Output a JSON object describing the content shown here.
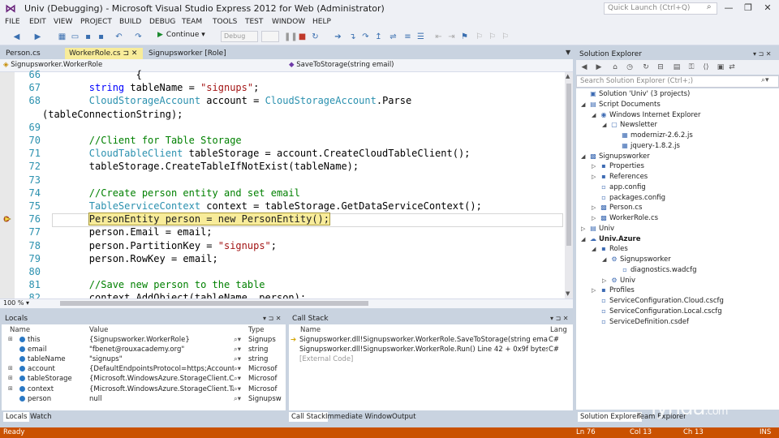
{
  "window": {
    "title": "Univ (Debugging) - Microsoft Visual Studio Express 2012 for Web (Administrator)",
    "quick_launch_placeholder": "Quick Launch (Ctrl+Q)",
    "minimize": "—",
    "restore": "❐",
    "close": "✕"
  },
  "menu": [
    "FILE",
    "EDIT",
    "VIEW",
    "PROJECT",
    "BUILD",
    "DEBUG",
    "TEAM",
    "TOOLS",
    "TEST",
    "WINDOW",
    "HELP"
  ],
  "toolbar": {
    "continue_label": "Continue",
    "continue_arrow": "▾",
    "config_value": "Debug",
    "icons": [
      "back-icon",
      "forward-icon",
      "new-project-icon",
      "open-icon",
      "save-icon",
      "save-all-icon",
      "undo-icon",
      "redo-icon"
    ]
  },
  "doc_tabs": [
    {
      "label": "Person.cs",
      "active": false
    },
    {
      "label": "WorkerRole.cs",
      "active": true,
      "pin": "⊐",
      "close": "✕"
    },
    {
      "label": "Signupsworker [Role]",
      "active": false
    }
  ],
  "nav": {
    "left": "Signupsworker.WorkerRole",
    "right": "SaveToStorage(string email)"
  },
  "editor": {
    "zoom": "100 %",
    "lines": [
      {
        "n": "66",
        "parts": [
          {
            "c": "pl",
            "t": "                {"
          }
        ]
      },
      {
        "n": "67",
        "parts": [
          {
            "c": "pl",
            "t": "        "
          },
          {
            "c": "kw",
            "t": "string"
          },
          {
            "c": "pl",
            "t": " tableName = "
          },
          {
            "c": "str",
            "t": "\"signups\""
          },
          {
            "c": "pl",
            "t": ";"
          }
        ]
      },
      {
        "n": "68",
        "parts": [
          {
            "c": "pl",
            "t": "        "
          },
          {
            "c": "ty",
            "t": "CloudStorageAccount"
          },
          {
            "c": "pl",
            "t": " account = "
          },
          {
            "c": "ty",
            "t": "CloudStorageAccount"
          },
          {
            "c": "pl",
            "t": ".Parse"
          }
        ]
      },
      {
        "n": "",
        "parts": [
          {
            "c": "pl",
            "t": "(tableConnectionString);"
          }
        ]
      },
      {
        "n": "69",
        "parts": []
      },
      {
        "n": "70",
        "parts": [
          {
            "c": "pl",
            "t": "        "
          },
          {
            "c": "cm",
            "t": "//Client for Table Storage"
          }
        ]
      },
      {
        "n": "71",
        "parts": [
          {
            "c": "pl",
            "t": "        "
          },
          {
            "c": "ty",
            "t": "CloudTableClient"
          },
          {
            "c": "pl",
            "t": " tableStorage = account.CreateCloudTableClient();"
          }
        ]
      },
      {
        "n": "72",
        "parts": [
          {
            "c": "pl",
            "t": "        tableStorage.CreateTableIfNotExist(tableName);"
          }
        ]
      },
      {
        "n": "73",
        "parts": []
      },
      {
        "n": "74",
        "parts": [
          {
            "c": "pl",
            "t": "        "
          },
          {
            "c": "cm",
            "t": "//Create person entity and set email"
          }
        ]
      },
      {
        "n": "75",
        "parts": [
          {
            "c": "pl",
            "t": "        "
          },
          {
            "c": "ty",
            "t": "TableServiceContext"
          },
          {
            "c": "pl",
            "t": " context = tableStorage.GetDataServiceContext();"
          }
        ]
      },
      {
        "n": "76",
        "parts": [
          {
            "c": "pl",
            "t": "        "
          },
          {
            "c": "cur",
            "t": "PersonEntity person = new PersonEntity();"
          }
        ]
      },
      {
        "n": "77",
        "parts": [
          {
            "c": "pl",
            "t": "        person.Email = email;"
          }
        ]
      },
      {
        "n": "78",
        "parts": [
          {
            "c": "pl",
            "t": "        person.PartitionKey = "
          },
          {
            "c": "str",
            "t": "\"signups\""
          },
          {
            "c": "pl",
            "t": ";"
          }
        ]
      },
      {
        "n": "79",
        "parts": [
          {
            "c": "pl",
            "t": "        person.RowKey = email;"
          }
        ]
      },
      {
        "n": "80",
        "parts": []
      },
      {
        "n": "81",
        "parts": [
          {
            "c": "pl",
            "t": "        "
          },
          {
            "c": "cm",
            "t": "//Save new person to the table"
          }
        ]
      },
      {
        "n": "82",
        "parts": [
          {
            "c": "pl",
            "t": "        context.AddObject(tableName, person);"
          }
        ]
      }
    ]
  },
  "locals": {
    "title": "Locals",
    "columns": [
      "Name",
      "Value",
      "Type"
    ],
    "rows": [
      {
        "exp": "⊞",
        "name": "this",
        "value": "{Signupsworker.WorkerRole}",
        "type": "Signups"
      },
      {
        "exp": "",
        "name": "email",
        "value": "\"fbenet@rouxacademy.org\"",
        "type": "string"
      },
      {
        "exp": "",
        "name": "tableName",
        "value": "\"signups\"",
        "type": "string"
      },
      {
        "exp": "⊞",
        "name": "account",
        "value": "{DefaultEndpointsProtocol=https;AccountName=u",
        "type": "Microsof"
      },
      {
        "exp": "⊞",
        "name": "tableStorage",
        "value": "{Microsoft.WindowsAzure.StorageClient.CloudTabl",
        "type": "Microsof"
      },
      {
        "exp": "⊞",
        "name": "context",
        "value": "{Microsoft.WindowsAzure.StorageClient.TableServic",
        "type": "Microsof"
      },
      {
        "exp": "",
        "name": "person",
        "value": "null",
        "type": "Signupsw"
      }
    ],
    "tabs": [
      "Locals",
      "Watch"
    ]
  },
  "callstack": {
    "title": "Call Stack",
    "columns": [
      "Name",
      "Lang"
    ],
    "rows": [
      {
        "name": "Signupsworker.dll!Signupsworker.WorkerRole.SaveToStorage(string email) Line 76",
        "lang": "C#",
        "current": true
      },
      {
        "name": "Signupsworker.dll!Signupsworker.WorkerRole.Run() Line 42 + 0x9f bytes",
        "lang": "C#",
        "current": false
      },
      {
        "name": "[External Code]",
        "lang": "",
        "current": false
      }
    ],
    "tabs": [
      "Call Stack",
      "Immediate Window",
      "Output"
    ]
  },
  "solution_explorer": {
    "title": "Solution Explorer",
    "search_placeholder": "Search Solution Explorer (Ctrl+;)",
    "tree": [
      {
        "depth": 0,
        "exp": "",
        "icon": "▣",
        "label": "Solution 'Univ' (3 projects)",
        "bold": false
      },
      {
        "depth": 0,
        "exp": "◢",
        "icon": "▤",
        "label": "Script Documents",
        "bold": false
      },
      {
        "depth": 1,
        "exp": "◢",
        "icon": "◉",
        "label": "Windows Internet Explorer",
        "bold": false
      },
      {
        "depth": 2,
        "exp": "◢",
        "icon": "▢",
        "label": "Newsletter",
        "bold": false
      },
      {
        "depth": 3,
        "exp": "",
        "icon": "▦",
        "label": "modernizr-2.6.2.js",
        "bold": false
      },
      {
        "depth": 3,
        "exp": "",
        "icon": "▦",
        "label": "jquery-1.8.2.js",
        "bold": false
      },
      {
        "depth": 0,
        "exp": "◢",
        "icon": "▩",
        "label": "Signupsworker",
        "bold": false
      },
      {
        "depth": 1,
        "exp": "▷",
        "icon": "▪",
        "label": "Properties",
        "bold": false
      },
      {
        "depth": 1,
        "exp": "▷",
        "icon": "▪",
        "label": "References",
        "bold": false
      },
      {
        "depth": 1,
        "exp": "",
        "icon": "▫",
        "label": "app.config",
        "bold": false
      },
      {
        "depth": 1,
        "exp": "",
        "icon": "▫",
        "label": "packages.config",
        "bold": false
      },
      {
        "depth": 1,
        "exp": "▷",
        "icon": "▩",
        "label": "Person.cs",
        "bold": false
      },
      {
        "depth": 1,
        "exp": "▷",
        "icon": "▩",
        "label": "WorkerRole.cs",
        "bold": false
      },
      {
        "depth": 0,
        "exp": "▷",
        "icon": "▤",
        "label": "Univ",
        "bold": false
      },
      {
        "depth": 0,
        "exp": "◢",
        "icon": "☁",
        "label": "Univ.Azure",
        "bold": true
      },
      {
        "depth": 1,
        "exp": "◢",
        "icon": "▪",
        "label": "Roles",
        "bold": false
      },
      {
        "depth": 2,
        "exp": "◢",
        "icon": "⚙",
        "label": "Signupsworker",
        "bold": false
      },
      {
        "depth": 3,
        "exp": "",
        "icon": "▫",
        "label": "diagnostics.wadcfg",
        "bold": false
      },
      {
        "depth": 2,
        "exp": "▷",
        "icon": "⚙",
        "label": "Univ",
        "bold": false
      },
      {
        "depth": 1,
        "exp": "▷",
        "icon": "▪",
        "label": "Profiles",
        "bold": false
      },
      {
        "depth": 1,
        "exp": "",
        "icon": "▫",
        "label": "ServiceConfiguration.Cloud.cscfg",
        "bold": false
      },
      {
        "depth": 1,
        "exp": "",
        "icon": "▫",
        "label": "ServiceConfiguration.Local.cscfg",
        "bold": false
      },
      {
        "depth": 1,
        "exp": "",
        "icon": "▫",
        "label": "ServiceDefinition.csdef",
        "bold": false
      }
    ],
    "tabs": [
      "Solution Explorer",
      "Team Explorer"
    ]
  },
  "statusbar": {
    "left": "Ready",
    "ln": "Ln 76",
    "col": "Col 13",
    "ch": "Ch 13",
    "mode": "INS"
  },
  "watermark": "lynda",
  "watermark_suffix": ".com",
  "colors": {
    "status_bar": "#ca5100",
    "current_statement": "#f8ec9a",
    "keyword": "#0000ff",
    "type": "#2b91af",
    "string": "#a31515",
    "comment": "#008000"
  }
}
